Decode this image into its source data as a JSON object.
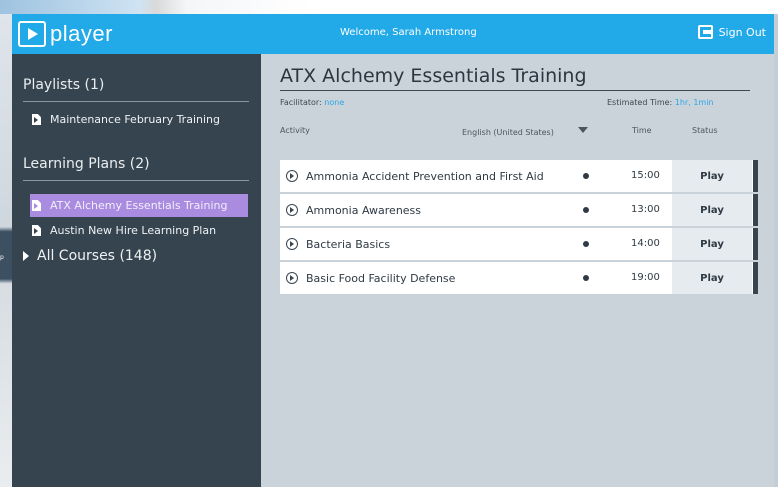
{
  "header": {
    "logo_text": "player",
    "welcome": "Welcome, Sarah Armstrong",
    "sign_out_label": "Sign Out",
    "accent_color": "#22a9e8"
  },
  "sidebar": {
    "playlists_heading": "Playlists (1)",
    "playlists": [
      {
        "label": "Maintenance February Training"
      }
    ],
    "learning_plans_heading": "Learning Plans (2)",
    "learning_plans": [
      {
        "label": "ATX Alchemy Essentials Training",
        "selected": true
      },
      {
        "label": "Austin New Hire Learning Plan",
        "selected": false
      }
    ],
    "all_courses_label": "All Courses",
    "all_courses_count": "(148)",
    "selected_color": "#a98be0"
  },
  "main": {
    "title": "ATX Alchemy Essentials Training",
    "facilitator_label": "Facilitator:",
    "facilitator_value": "none",
    "estimated_label": "Estimated Time:",
    "estimated_value": "1hr, 1min",
    "columns": {
      "activity": "Activity",
      "language": "English (United States)",
      "time": "Time",
      "status": "Status"
    },
    "rows": [
      {
        "name": "Ammonia Accident Prevention and First Aid",
        "time": "15:00",
        "status": "Play"
      },
      {
        "name": "Ammonia Awareness",
        "time": "13:00",
        "status": "Play"
      },
      {
        "name": "Bacteria Basics",
        "time": "14:00",
        "status": "Play"
      },
      {
        "name": "Basic Food Facility Defense",
        "time": "19:00",
        "status": "Play"
      }
    ]
  }
}
